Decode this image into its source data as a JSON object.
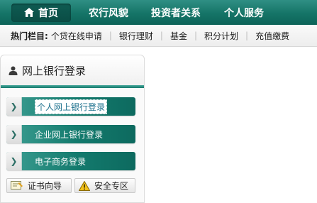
{
  "topnav": {
    "home_label": "首页",
    "items": [
      "农行风貌",
      "投资者关系",
      "个人服务"
    ]
  },
  "hotbar": {
    "title": "热门栏目:",
    "links": [
      "个贷在线申请",
      "银行理财",
      "基金",
      "积分计划",
      "充值缴费"
    ]
  },
  "login_panel": {
    "title": "网上银行登录",
    "buttons": [
      {
        "label": "个人网上银行登录",
        "selected": true
      },
      {
        "label": "企业网上银行登录",
        "selected": false
      },
      {
        "label": "电子商务登录",
        "selected": false
      }
    ],
    "mini_buttons": [
      "证书向导",
      "安全专区"
    ]
  },
  "colors": {
    "brand_green": "#157467",
    "button_green": "#137a6d"
  }
}
